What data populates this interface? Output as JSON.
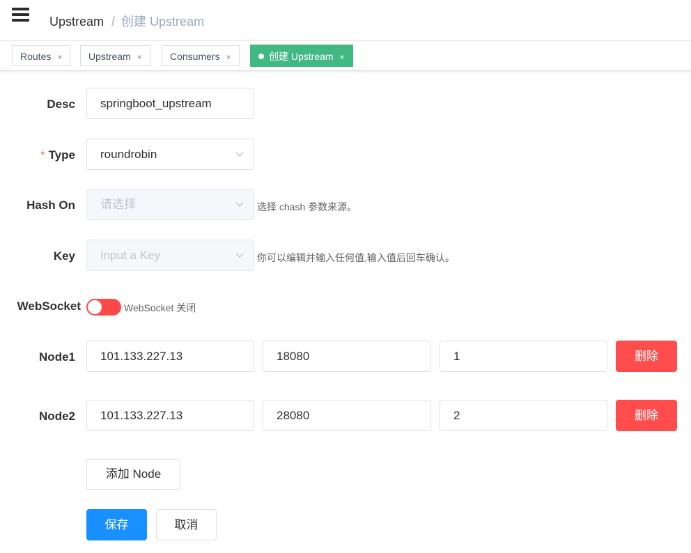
{
  "header": {
    "breadcrumb_home": "Upstream",
    "breadcrumb_sep": "/",
    "breadcrumb_current": "创建 Upstream"
  },
  "tags": [
    {
      "label": "Routes",
      "close": "×"
    },
    {
      "label": "Upstream",
      "close": "×"
    },
    {
      "label": "Consumers",
      "close": "×"
    },
    {
      "label": "创建 Upstream",
      "close": "×",
      "active": true
    }
  ],
  "form": {
    "desc": {
      "label": "Desc",
      "value": "springboot_upstream"
    },
    "type": {
      "required_mark": "*",
      "label": "Type",
      "value": "roundrobin"
    },
    "hash_on": {
      "label": "Hash On",
      "placeholder": "请选择",
      "hint": "选择 chash 参数来源。"
    },
    "key": {
      "label": "Key",
      "placeholder": "Input a Key",
      "hint": "你可以编辑并输入任何值,输入值后回车确认。"
    },
    "websocket": {
      "label": "WebSocket",
      "enabled": false,
      "status_text": "WebSocket 关闭"
    },
    "nodes": [
      {
        "label": "Node1",
        "host": "101.133.227.13",
        "port": "18080",
        "weight": "1",
        "delete_label": "删除"
      },
      {
        "label": "Node2",
        "host": "101.133.227.13",
        "port": "28080",
        "weight": "2",
        "delete_label": "删除"
      }
    ],
    "add_node_label": "添加 Node",
    "save_label": "保存",
    "cancel_label": "取消"
  },
  "colors": {
    "active_tag": "#42b983",
    "danger": "#ff4d4d",
    "primary": "#1890ff",
    "required": "#f56c6c"
  }
}
